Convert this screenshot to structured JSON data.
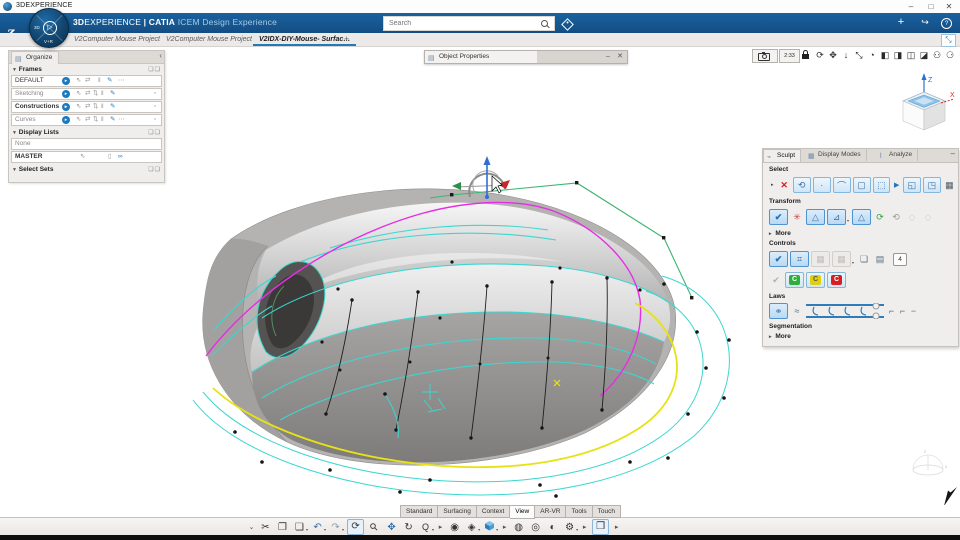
{
  "window": {
    "title": "3DEXPERIENCE",
    "minimize": "–",
    "maximize": "□",
    "close": "✕"
  },
  "colors": {
    "header_blue": "#16588e",
    "accent_blue": "#1b79c0",
    "underline": "#1e7bc0",
    "cyan": "#3cd6cf",
    "magenta": "#e52ee5",
    "green": "#3cb46e",
    "yellow": "#e6e215",
    "body_gray": "#b5b3b1"
  },
  "header": {
    "brand_bold": "3D",
    "brand_rest": "EXPERIENCE",
    "pipe": "|",
    "app_bold": "CATIA",
    "app_rest": "ICEM Design Experience",
    "search_placeholder": "Search",
    "add": "+",
    "share": "↪",
    "help": "?"
  },
  "compass": {
    "label_left": "3D",
    "label_bottom": "V+R",
    "play": "▷"
  },
  "tabs": {
    "items": [
      {
        "label": "V2Computer Mouse Project"
      },
      {
        "label": "V2Computer Mouse Project"
      },
      {
        "label": "V2IDX-DIY-Mouse- Surfac…"
      }
    ],
    "new_tab": "+",
    "restore": "⤡"
  },
  "left_panel": {
    "tab": "Organize",
    "tab_icon": "▤",
    "collapse": "‹",
    "section_arrow": "▼",
    "header_badges": "❏❏",
    "frames": {
      "title": "Frames",
      "rows": [
        {
          "name": "DEFAULT"
        },
        {
          "name": "Sketching"
        },
        {
          "name": "Constructions"
        },
        {
          "name": "Curves"
        }
      ]
    },
    "display_lists": {
      "title": "Display Lists",
      "none": "None",
      "master": "MASTER"
    },
    "select_sets": {
      "title": "Select Sets"
    },
    "glyphs": {
      "play": "▸",
      "cursor": "⇖",
      "swap": "⇄",
      "swap2": "⇅",
      "cols": "‖",
      "pen": "✎",
      "dots": "⋯",
      "box": "▫",
      "bar": "▯",
      "glasses": "∞",
      "one": "❘"
    }
  },
  "object_properties": {
    "title": "Object Properties",
    "icon": "▤",
    "minimize": "–",
    "close": "✕"
  },
  "view_toolbar": {
    "timer": "2:33",
    "icons": [
      {
        "name": "rotate-icon",
        "glyph": "⟳"
      },
      {
        "name": "pan-icon",
        "glyph": "✥"
      },
      {
        "name": "arrow-down-icon",
        "glyph": "↓"
      },
      {
        "name": "resize-icon",
        "glyph": "⤡"
      },
      {
        "name": "globe-icon",
        "glyph": "◔"
      },
      {
        "name": "contrast-icon",
        "glyph": "◧"
      },
      {
        "name": "invert-icon",
        "glyph": "◨"
      },
      {
        "name": "split-view-icon",
        "glyph": "◫"
      },
      {
        "name": "cube-icon",
        "glyph": "◪"
      },
      {
        "name": "users-icon",
        "glyph": "⚇"
      },
      {
        "name": "user-icon",
        "glyph": "⚆"
      },
      {
        "name": "settings-icon",
        "glyph": "⚙"
      }
    ]
  },
  "sculpt_panel": {
    "tabs": [
      {
        "label": "Sculpt",
        "icon": "⌁"
      },
      {
        "label": "Display Modes",
        "icon": "▦"
      },
      {
        "label": "Analyze",
        "icon": "⌇"
      }
    ],
    "minimize": "–",
    "sections": {
      "select": "Select",
      "transform": "Transform",
      "more1": "More",
      "controls": "Controls",
      "laws": "Laws",
      "segmentation": "Segmentation",
      "more2": "More"
    },
    "arrow": "▸",
    "play": "▶",
    "check": "✔",
    "delete_x": "✕",
    "select_icons": [
      {
        "name": "select-rotate",
        "glyph": "⟲"
      },
      {
        "name": "select-point",
        "glyph": "∙"
      },
      {
        "name": "select-curve",
        "glyph": "⌒"
      },
      {
        "name": "select-surface",
        "glyph": "▢"
      },
      {
        "name": "select-box",
        "glyph": "⬚"
      }
    ],
    "select_icons2": [
      {
        "name": "select-cube-a",
        "glyph": "◱"
      },
      {
        "name": "select-cube-b",
        "glyph": "◳"
      }
    ],
    "grid_icon": "▦",
    "transform_icons": {
      "star": "✳",
      "t1": "△",
      "t2": "⊿",
      "t3": "△",
      "rot_green": "⟳",
      "rot_gray": "⟲",
      "dis1": "◇",
      "dis2": "◇"
    },
    "controls_icons": {
      "cage": "⌗",
      "grid1": "▦",
      "grid2": "▦",
      "boxarrow": "❏",
      "stack": "▤",
      "badge": "4"
    },
    "c_buttons": [
      {
        "label": "C",
        "color": "#2fae3e"
      },
      {
        "label": "C",
        "color": "#e0cf10"
      },
      {
        "label": "C",
        "color": "#d42020"
      }
    ],
    "laws_icons": {
      "link": "⚭",
      "curve": "≈",
      "trail1": "⌐",
      "trail2": "⌐",
      "trail3": "−"
    },
    "dropdown": "▾"
  },
  "bottom": {
    "tabs": [
      {
        "label": "Standard"
      },
      {
        "label": "Surfacing"
      },
      {
        "label": "Context"
      },
      {
        "label": "View"
      },
      {
        "label": "AR-VR"
      },
      {
        "label": "Tools"
      },
      {
        "label": "Touch"
      }
    ],
    "icons": {
      "chevron": "⌄",
      "cut": "✂",
      "copy": "❐",
      "paste": "❏",
      "undo": "↶",
      "redo": "↷",
      "update": "⟳",
      "zoom_fit": "⚲",
      "pan": "✥",
      "orbit": "↻",
      "zoom": "Q",
      "arrow": "▸",
      "camera": "◉",
      "iso": "◈",
      "shade1": "◍",
      "shade2": "◎",
      "shade3": "◐",
      "gear": "⚙",
      "pick": "❒",
      "dropdown": "▾"
    }
  },
  "viewport": {
    "axis_z": "Z",
    "axis_x": "X",
    "axis_x_small": "x",
    "axis_z_small": "z"
  }
}
